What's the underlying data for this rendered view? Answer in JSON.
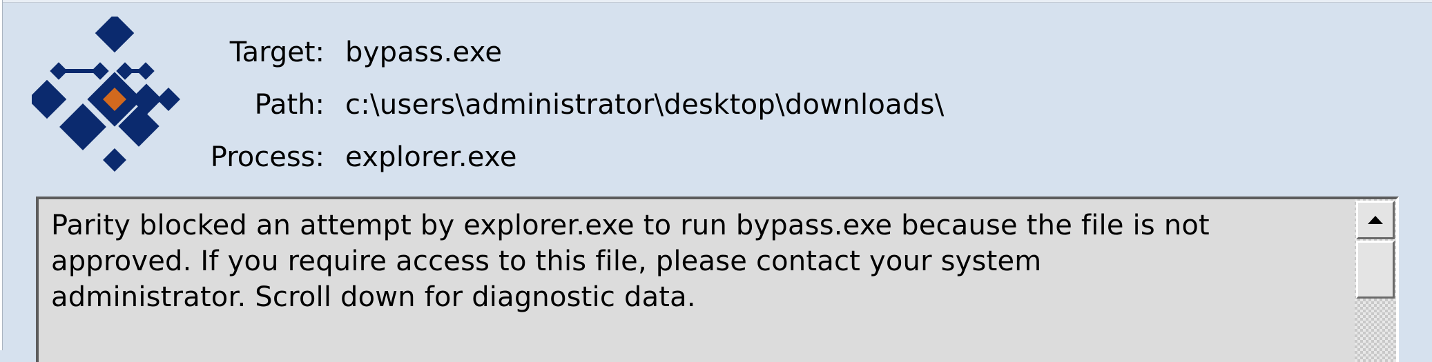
{
  "details": {
    "target_label": "Target:",
    "target_value": "bypass.exe",
    "path_label": "Path:",
    "path_value": "c:\\users\\administrator\\desktop\\downloads\\",
    "process_label": "Process:",
    "process_value": "explorer.exe"
  },
  "message": {
    "text": "Parity blocked an attempt by explorer.exe to run bypass.exe because the file is not\napproved.  If you require access to this file, please contact your system\nadministrator.  Scroll down for diagnostic data."
  },
  "icons": {
    "logo": "parity-logo-icon",
    "scroll_up": "arrow-up-icon"
  },
  "colors": {
    "background": "#d6e1ee",
    "logo_blue": "#0b2a6e",
    "logo_orange": "#d2691e",
    "message_bg": "#dcdcdc"
  }
}
